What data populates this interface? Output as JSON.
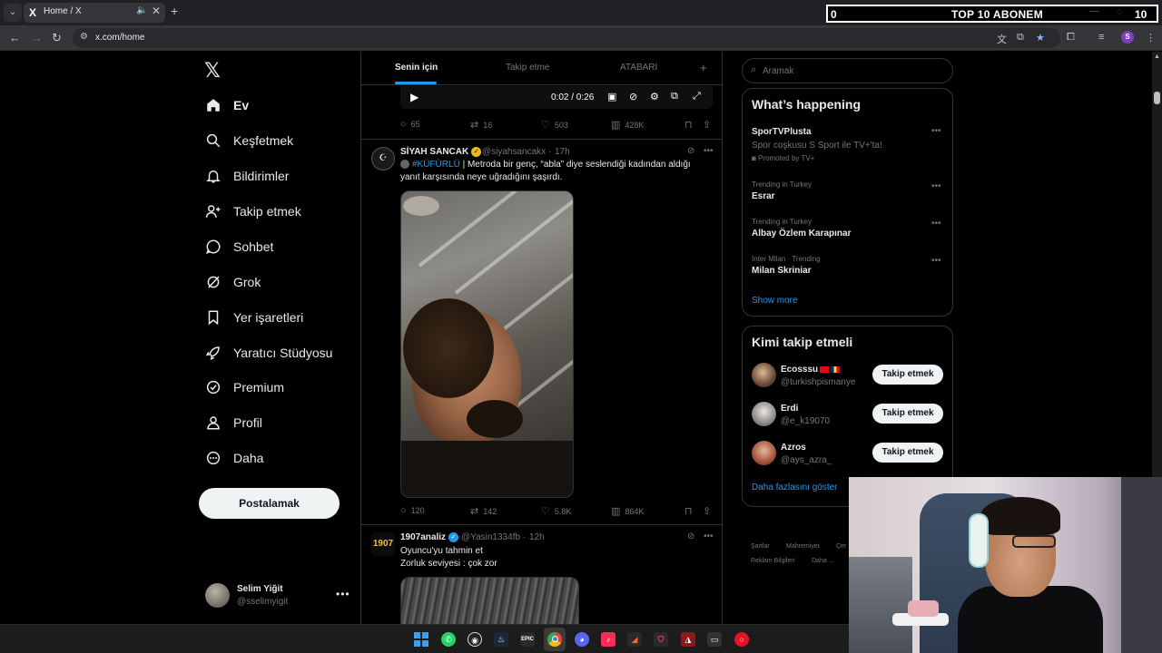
{
  "browser": {
    "tab_title": "Home / X",
    "tab_favicon": "X",
    "url": "x.com/home",
    "profile_initial": "S",
    "icons": [
      "back-icon",
      "forward-icon",
      "reload-icon",
      "translate-icon",
      "cast-icon",
      "bookmark-star-icon",
      "extensions-icon",
      "tab-search-icon",
      "more-icon"
    ]
  },
  "overlay": {
    "left_count": "0",
    "title": "TOP 10 ABONEM",
    "right_count": "10"
  },
  "nav": {
    "items": [
      {
        "label": "Ev",
        "icon": "home-icon",
        "active": true
      },
      {
        "label": "Keşfetmek",
        "icon": "search-icon"
      },
      {
        "label": "Bildirimler",
        "icon": "bell-icon"
      },
      {
        "label": "Takip etmek",
        "icon": "add-person-icon"
      },
      {
        "label": "Sohbet",
        "icon": "chat-icon"
      },
      {
        "label": "Grok",
        "icon": "grok-icon"
      },
      {
        "label": "Yer işaretleri",
        "icon": "bookmark-icon"
      },
      {
        "label": "Yaratıcı Stüdyosu",
        "icon": "rocket-icon"
      },
      {
        "label": "Premium",
        "icon": "verified-icon"
      },
      {
        "label": "Profil",
        "icon": "person-icon"
      },
      {
        "label": "Daha",
        "icon": "more-circle-icon"
      }
    ],
    "post_button": "Postalamak",
    "account": {
      "name": "Selim Yiğit",
      "handle": "@sselimyigit"
    }
  },
  "feed": {
    "tabs": [
      "Senin için",
      "Takip etme",
      "ATABARI"
    ],
    "video": {
      "time": "0:02 / 0:26"
    },
    "tweet0_actions": {
      "replies": "65",
      "reposts": "16",
      "likes": "503",
      "views": "428K"
    },
    "tweet1": {
      "name": "SİYAH SANCAK",
      "handle": "@siyahsancakx",
      "time": "17h",
      "hashtag": "#KÜFÜRLÜ",
      "text": " | Metroda bir genç, “abla” diye seslendiği kadından aldığı yanıt karşısında neye uğradığını şaşırdı.",
      "actions": {
        "replies": "120",
        "reposts": "142",
        "likes": "5.8K",
        "views": "864K"
      }
    },
    "tweet2": {
      "name": "1907analiz",
      "handle": "@Yasin1334fb",
      "time": "12h",
      "line1": "Oyuncu'yu tahmin et",
      "line2": "Zorluk seviyesi : çok zor",
      "avatar_text": "1907"
    }
  },
  "sidebar": {
    "search_placeholder": "Aramak",
    "happening_title": "What’s happening",
    "trends": [
      {
        "meta": "",
        "name": "SporTVPlusta",
        "desc": "Spor coşkusu S Sport ile TV+'ta!",
        "promo": "Promoted by TV+"
      },
      {
        "meta": "Trending in Turkey",
        "name": "Esrar"
      },
      {
        "meta": "Trending in Turkey",
        "name": "Albay Özlem Karapınar"
      },
      {
        "meta": "Inter Milan · Trending",
        "name": "Milan Skriniar"
      }
    ],
    "show_more": "Show more",
    "wtf_title": "Kimi takip etmeli",
    "who_to_follow": [
      {
        "name": "Ecosssu",
        "handle": "@turkishpismanye",
        "button": "Takip etmek"
      },
      {
        "name": "Erdi",
        "handle": "@e_k19070",
        "button": "Takip etmek"
      },
      {
        "name": "Azros",
        "handle": "@ays_azra_",
        "button": "Takip etmek"
      }
    ],
    "wtf_more": "Daha fazlasını göster",
    "footer": [
      "Şartlar",
      "Mahremiyet",
      "Çer",
      "Reklam Bilgileri",
      "Daha ..."
    ]
  },
  "taskbar": {
    "icons": [
      "windows-icon",
      "whatsapp-icon",
      "obs-icon",
      "steam-icon",
      "epic-icon",
      "chrome-icon",
      "discord-icon",
      "tiktok-icon",
      "app-icon",
      "valorant-icon",
      "game-icon",
      "terminal-icon",
      "recorder-icon"
    ],
    "epic_label": "EPIC"
  }
}
